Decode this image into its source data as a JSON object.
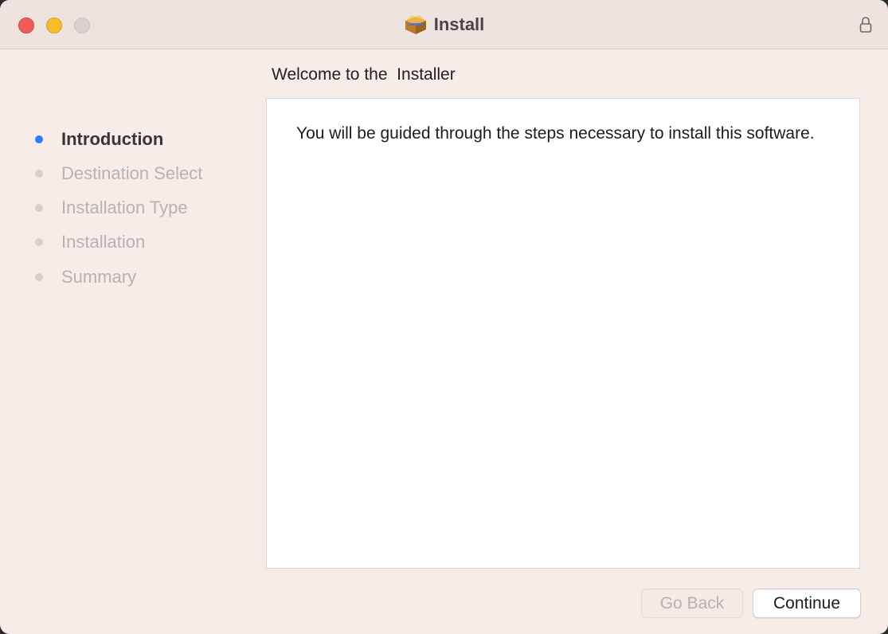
{
  "window": {
    "title": "Install",
    "title_icon": "package-icon",
    "lock_icon": "lock-icon"
  },
  "sidebar": {
    "steps": [
      {
        "label": "Introduction",
        "state": "active"
      },
      {
        "label": "Destination Select",
        "state": "inactive"
      },
      {
        "label": "Installation Type",
        "state": "inactive"
      },
      {
        "label": "Installation",
        "state": "inactive"
      },
      {
        "label": "Summary",
        "state": "inactive"
      }
    ]
  },
  "main": {
    "heading": "Welcome to the  Installer",
    "body": "You will be guided through the steps necessary to install this software."
  },
  "buttons": {
    "back_label": "Go Back",
    "back_enabled": false,
    "continue_label": "Continue"
  },
  "colors": {
    "active_step": "#2f7cf6",
    "close": "#ee5e57",
    "minimize": "#f5be2e",
    "zoom_disabled": "#d8d2cf",
    "window_bg": "#f6ece8"
  }
}
